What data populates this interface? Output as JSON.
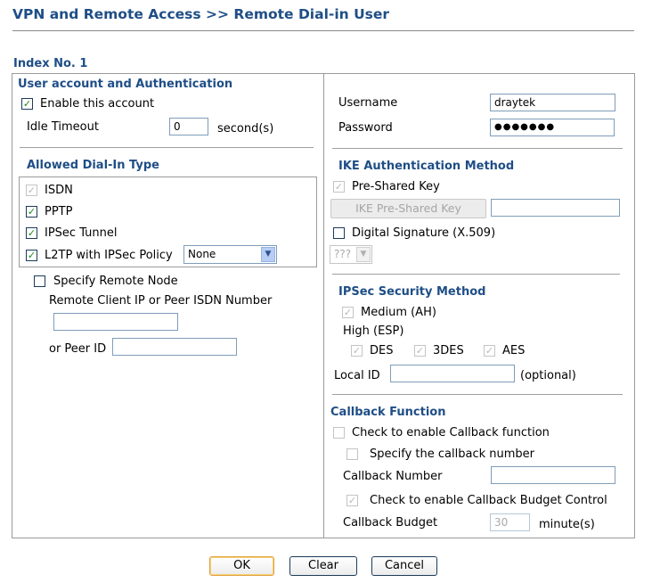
{
  "page": {
    "title": "VPN and Remote Access >> Remote Dial-in User",
    "index_label": "Index No. 1"
  },
  "left": {
    "section_title": "User account and Authentication",
    "enable_account": {
      "label": "Enable this account",
      "checked": true
    },
    "idle_timeout": {
      "label": "Idle Timeout",
      "value": "0",
      "unit": "second(s)"
    },
    "dial_in": {
      "section_title": "Allowed Dial-In Type",
      "isdn": {
        "label": "ISDN",
        "checked": true,
        "disabled": true
      },
      "pptp": {
        "label": "PPTP",
        "checked": true
      },
      "ipsec": {
        "label": "IPSec Tunnel",
        "checked": true
      },
      "l2tp": {
        "label": "L2TP with IPSec Policy",
        "checked": true,
        "policy_value": "None"
      }
    },
    "remote_node": {
      "label": "Specify Remote Node",
      "checked": false,
      "remote_ip_label": "Remote Client IP or Peer ISDN Number",
      "remote_ip_value": "",
      "peer_id_label": "or Peer ID",
      "peer_id_value": ""
    }
  },
  "right": {
    "username": {
      "label": "Username",
      "value": "draytek"
    },
    "password": {
      "label": "Password",
      "value": "●●●●●●●"
    },
    "ike": {
      "section_title": "IKE Authentication Method",
      "pre_shared_key": {
        "label": "Pre-Shared Key",
        "checked": true,
        "disabled": true
      },
      "psk_button": "IKE Pre-Shared Key",
      "psk_value": "",
      "digital_signature": {
        "label": "Digital Signature (X.509)",
        "checked": false
      },
      "cert_select": "???"
    },
    "ipsec_security": {
      "section_title": "IPSec Security Method",
      "medium_ah": {
        "label": "Medium (AH)",
        "checked": true
      },
      "high_esp": "High (ESP)",
      "des": {
        "label": "DES",
        "checked": true
      },
      "tdes": {
        "label": "3DES",
        "checked": true
      },
      "aes": {
        "label": "AES",
        "checked": true
      },
      "local_id": {
        "label": "Local ID",
        "value": "",
        "hint": "(optional)"
      }
    },
    "callback": {
      "section_title": "Callback Function",
      "enable": {
        "label": "Check to enable Callback function",
        "checked": false
      },
      "specify_number": {
        "label": "Specify the callback number",
        "checked": false
      },
      "number_label": "Callback Number",
      "number_value": "",
      "budget_control": {
        "label": "Check to enable Callback Budget Control",
        "checked": true
      },
      "budget_label": "Callback Budget",
      "budget_value": "30",
      "budget_unit": "minute(s)"
    }
  },
  "buttons": {
    "ok": "OK",
    "clear": "Clear",
    "cancel": "Cancel"
  },
  "colors": {
    "heading": "#1f4e86",
    "check": "#1a8a1a",
    "border": "#9a9a9a"
  },
  "icons": {
    "check": "✓",
    "dropdown": "▼"
  }
}
